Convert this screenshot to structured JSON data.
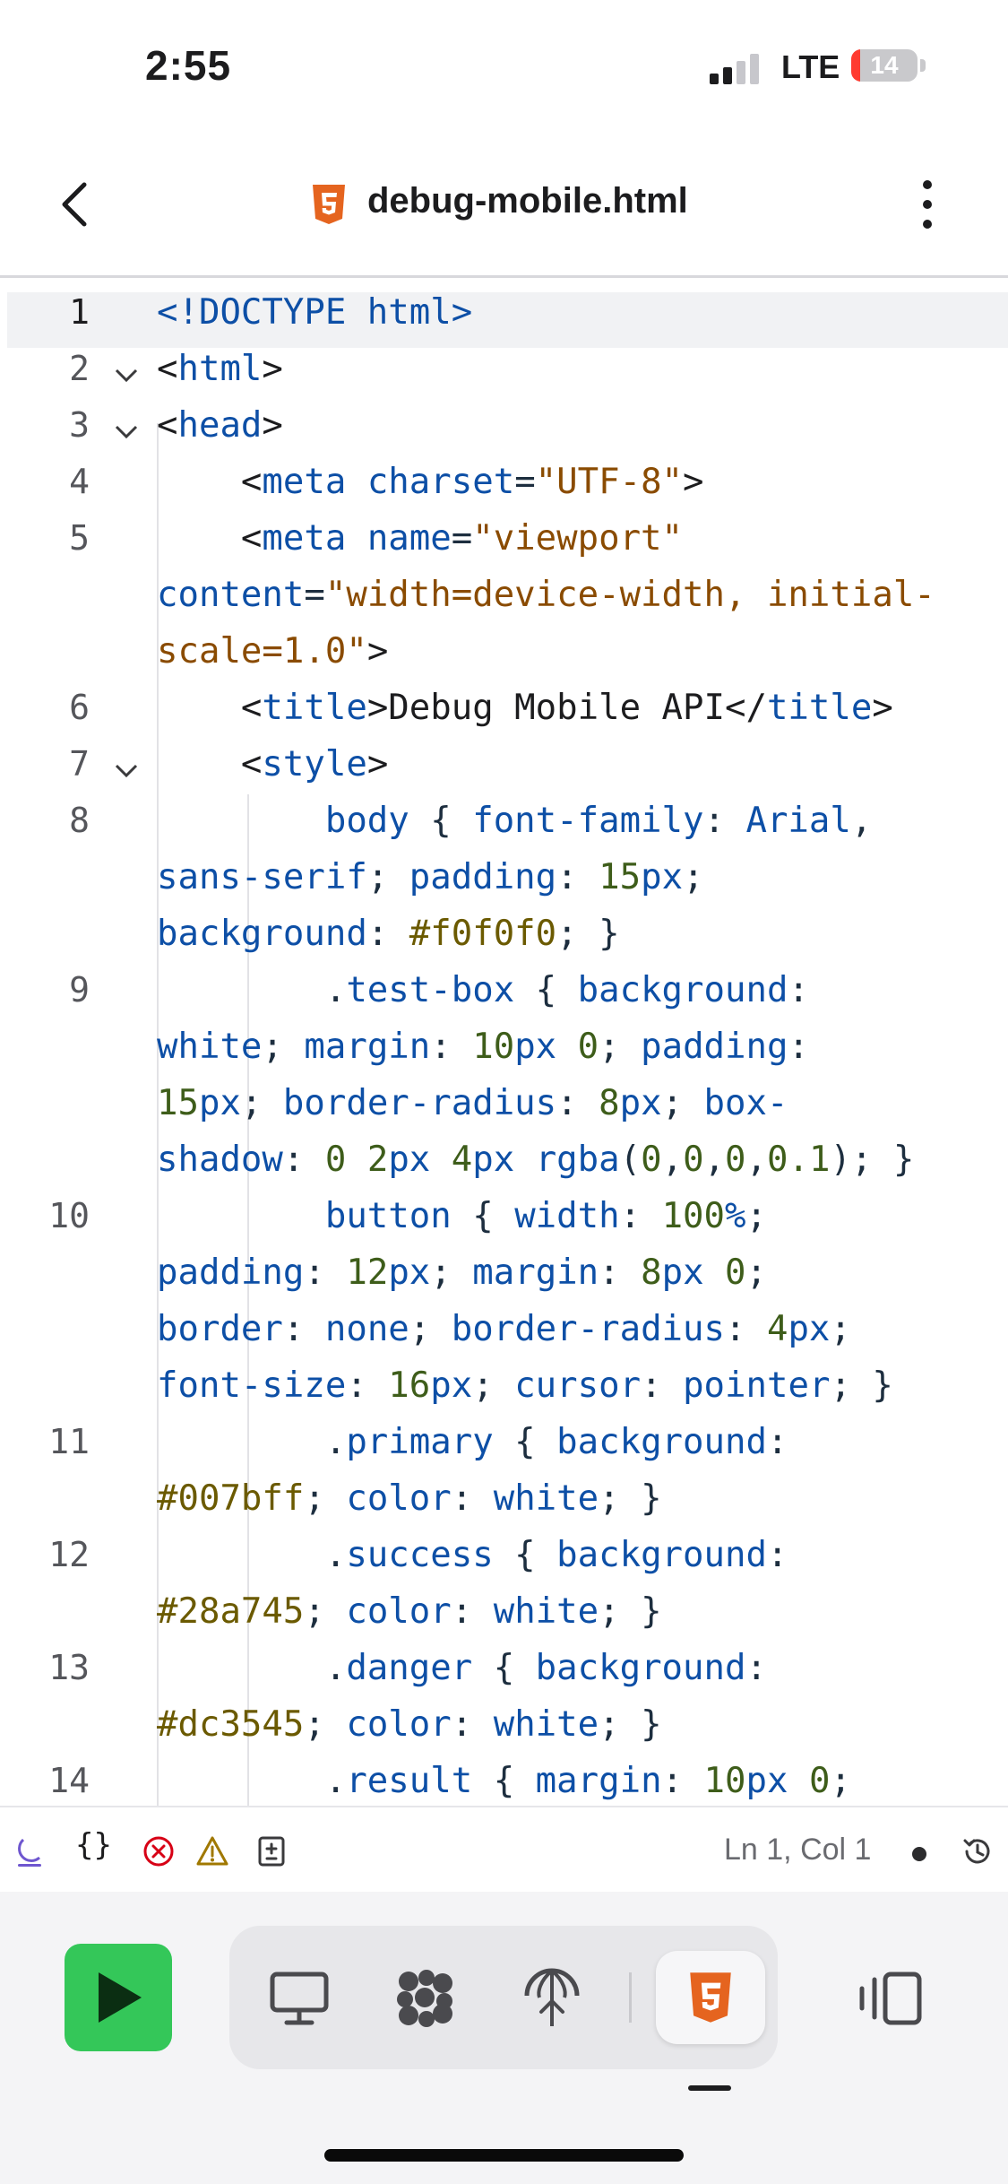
{
  "status_bar": {
    "time": "2:55",
    "network": "LTE",
    "battery": "14"
  },
  "nav": {
    "file_name": "debug-mobile.html",
    "back_icon": "chevron-left-icon",
    "more_icon": "more-vertical-icon"
  },
  "colors": {
    "tag": "#0d4fa6",
    "attr_value": "#8a4b00",
    "number": "#3e5d1a",
    "hex": "#6b5a00",
    "run_green": "#34c759",
    "html5_orange": "#e5641f"
  },
  "editor": {
    "line_numbers": [
      "1",
      "2",
      "3",
      "4",
      "5",
      "6",
      "7",
      "8",
      "9",
      "10",
      "11",
      "12",
      "13",
      "14"
    ],
    "active_line": "1"
  },
  "status_strip": {
    "cursor_position": "Ln 1, Col 1",
    "braces": "{}"
  }
}
